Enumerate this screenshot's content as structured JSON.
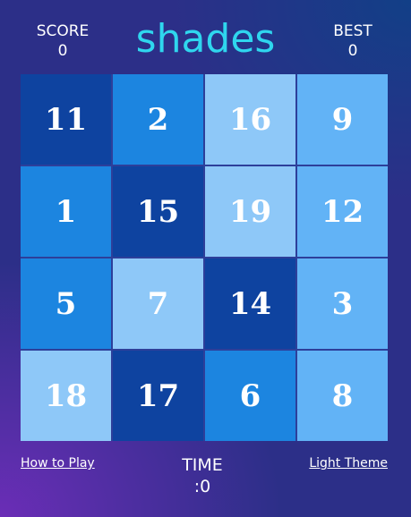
{
  "header": {
    "score_label": "SCORE",
    "score_value": "0",
    "logo_text": "shades",
    "best_label": "BEST",
    "best_value": "0"
  },
  "shade_colors": {
    "dark": "#0e43a0",
    "medium": "#1c85e0",
    "light": "#8ec8f8",
    "sky": "#62b3f6"
  },
  "accent_color": "#2fd6ee",
  "board": {
    "rows": [
      [
        {
          "value": "11",
          "shade": "dark"
        },
        {
          "value": "2",
          "shade": "medium"
        },
        {
          "value": "16",
          "shade": "light"
        },
        {
          "value": "9",
          "shade": "sky"
        }
      ],
      [
        {
          "value": "1",
          "shade": "medium"
        },
        {
          "value": "15",
          "shade": "dark"
        },
        {
          "value": "19",
          "shade": "light"
        },
        {
          "value": "12",
          "shade": "sky"
        }
      ],
      [
        {
          "value": "5",
          "shade": "medium"
        },
        {
          "value": "7",
          "shade": "light"
        },
        {
          "value": "14",
          "shade": "dark"
        },
        {
          "value": "3",
          "shade": "sky"
        }
      ],
      [
        {
          "value": "18",
          "shade": "light"
        },
        {
          "value": "17",
          "shade": "dark"
        },
        {
          "value": "6",
          "shade": "medium"
        },
        {
          "value": "8",
          "shade": "sky"
        }
      ]
    ]
  },
  "footer": {
    "how_to_play": "How to Play",
    "time_label": "TIME",
    "time_value": ":0",
    "theme_toggle": "Light Theme"
  }
}
